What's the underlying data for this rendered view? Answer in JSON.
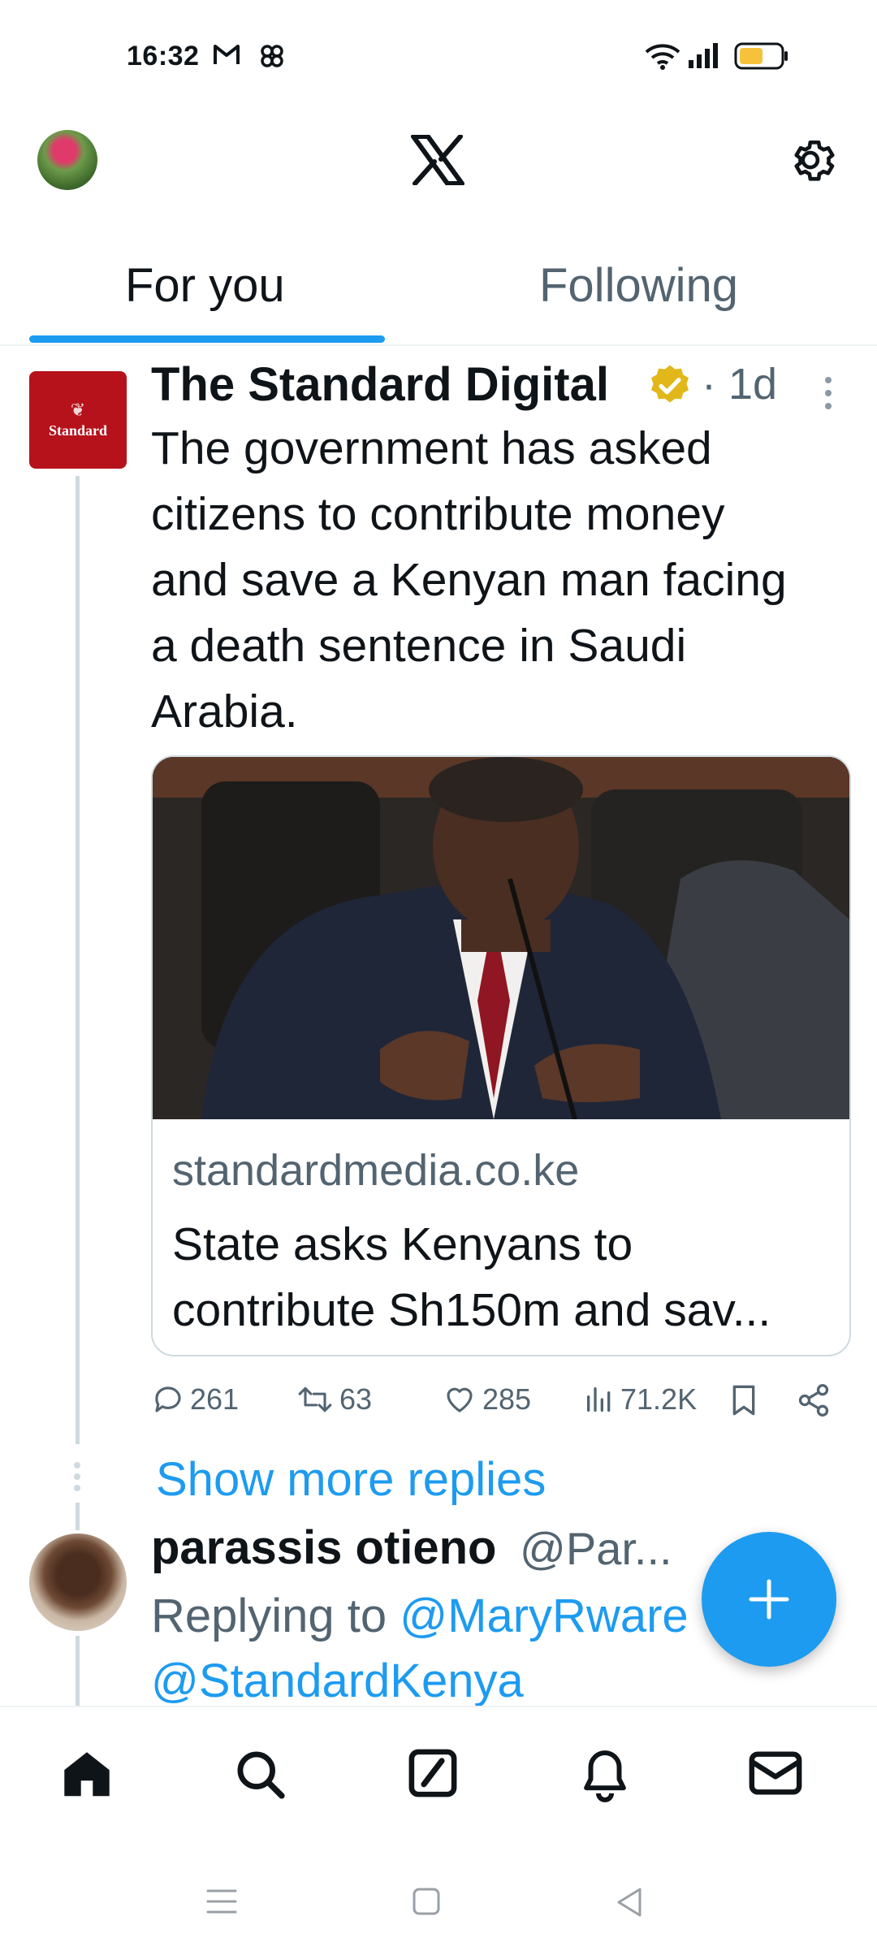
{
  "status_bar": {
    "time": "16:32",
    "battery_color": "#f6c23c"
  },
  "header": {
    "logo_icon": "x-logo-icon",
    "settings_icon": "gear-icon"
  },
  "tabs": [
    {
      "label": "For you",
      "active": true
    },
    {
      "label": "Following",
      "active": false
    }
  ],
  "tweet1": {
    "avatar_label": "Standard",
    "author_name": "The Standard Digital",
    "verified": true,
    "time": "· 1d",
    "text": "The government has asked\ncitizens to contribute money\nand save a Kenyan man facing\na death sentence in Saudi\nArabia.",
    "card": {
      "domain": "standardmedia.co.ke",
      "title": "State asks Kenyans to\ncontribute Sh150m and sav..."
    },
    "actions": {
      "replies": "261",
      "retweets": "63",
      "likes": "285",
      "views": "71.2K"
    }
  },
  "thread": {
    "show_more_label": "Show more replies"
  },
  "tweet2": {
    "author_name": "parassis otieno",
    "handle": "@Par...",
    "replying_prefix": "Replying to ",
    "mention1": "@MaryRware",
    "mention2": "@StandardKenya"
  },
  "colors": {
    "accent": "#1d9bf0",
    "secondary_text": "#536471",
    "primary_text": "#0f1419",
    "brand_red": "#b5121b"
  }
}
